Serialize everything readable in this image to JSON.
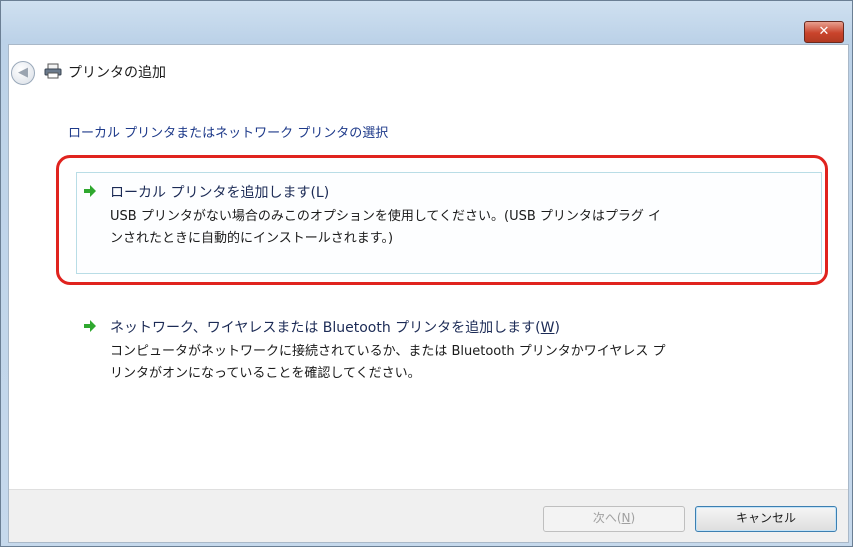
{
  "window": {
    "title": "プリンタの追加",
    "close_label": "✕"
  },
  "heading": "ローカル プリンタまたはネットワーク プリンタの選択",
  "options": [
    {
      "title": "ローカル プリンタを追加します(L)",
      "desc_line1": "USB プリンタがない場合のみこのオプションを使用してください。(USB プリンタはプラグ イ",
      "desc_line2": "ンされたときに自動的にインストールされます。)"
    },
    {
      "title_prefix": "ネットワーク、ワイヤレスまたは Bluetooth プリンタを追加します(",
      "title_key": "W",
      "title_suffix": ")",
      "desc_line1": "コンピュータがネットワークに接続されているか、または Bluetooth プリンタかワイヤレス プ",
      "desc_line2": "リンタがオンになっていることを確認してください。"
    }
  ],
  "buttons": {
    "next_prefix": "次へ(",
    "next_key": "N",
    "next_suffix": ")",
    "cancel": "キャンセル"
  },
  "icons": {
    "back": "back-arrow-icon",
    "printer": "printer-icon",
    "option_arrow": "green-arrow-icon",
    "close": "close-icon"
  },
  "colors": {
    "highlight": "#e0231e",
    "arrow": "#2fa82f",
    "heading": "#1e3a8a"
  }
}
